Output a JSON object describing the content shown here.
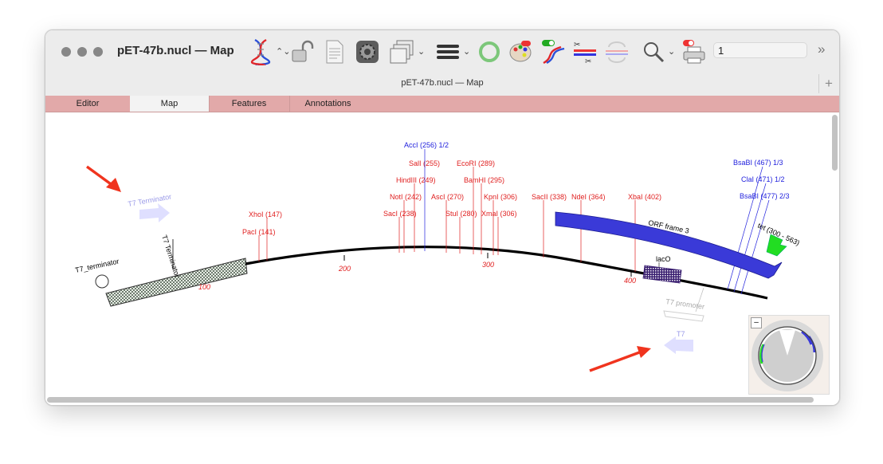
{
  "window": {
    "title": "pET-47b.nucl — Map",
    "subtitle": "pET-47b.nucl — Map",
    "toolbar_input_value": "1",
    "plus_label": "+",
    "more_label": "»"
  },
  "tabs": [
    {
      "label": "Editor",
      "active": false
    },
    {
      "label": "Map",
      "active": true
    },
    {
      "label": "Features",
      "active": false
    },
    {
      "label": "Annotations",
      "active": false
    }
  ],
  "map": {
    "ticks": [
      "100",
      "200",
      "300",
      "400"
    ],
    "sites_red": [
      {
        "label": "PacI (141)"
      },
      {
        "label": "XhoI (147)"
      },
      {
        "label": "SacI (238)"
      },
      {
        "label": "NotI (242)"
      },
      {
        "label": "HindIII (249)"
      },
      {
        "label": "SalI (255)"
      },
      {
        "label": "AscI (270)"
      },
      {
        "label": "StuI (280)"
      },
      {
        "label": "EcoRI (289)"
      },
      {
        "label": "BamHI (295)"
      },
      {
        "label": "KpnI (306)"
      },
      {
        "label": "XmaI (306)"
      },
      {
        "label": "SacII (338)"
      },
      {
        "label": "NdeI (364)"
      },
      {
        "label": "XbaI (402)"
      }
    ],
    "sites_blue": [
      {
        "label": "AccI (256) 1/2"
      },
      {
        "label": "BsaBI (467) 1/3"
      },
      {
        "label": "ClaI (471) 1/2"
      },
      {
        "label": "BsaBI (477) 2/3"
      }
    ],
    "features": {
      "t7_terminator_arrow": "T7 Terminator",
      "t7_terminator_rot": "T7 Terminator",
      "t7_terminator_circle": "T7_terminator",
      "orf": "ORF frame 3",
      "lacO": "lacO",
      "tet": "tet (300 - 563)",
      "t7_promoter": "T7 promoter",
      "t7": "T7"
    },
    "minimap_minus": "–"
  },
  "colors": {
    "tabs_bg": "#e2a9a9",
    "site_red": "#e02020",
    "site_blue": "#2222dd",
    "orf": "#3a3ad8",
    "arrow_red": "#f0341e"
  }
}
